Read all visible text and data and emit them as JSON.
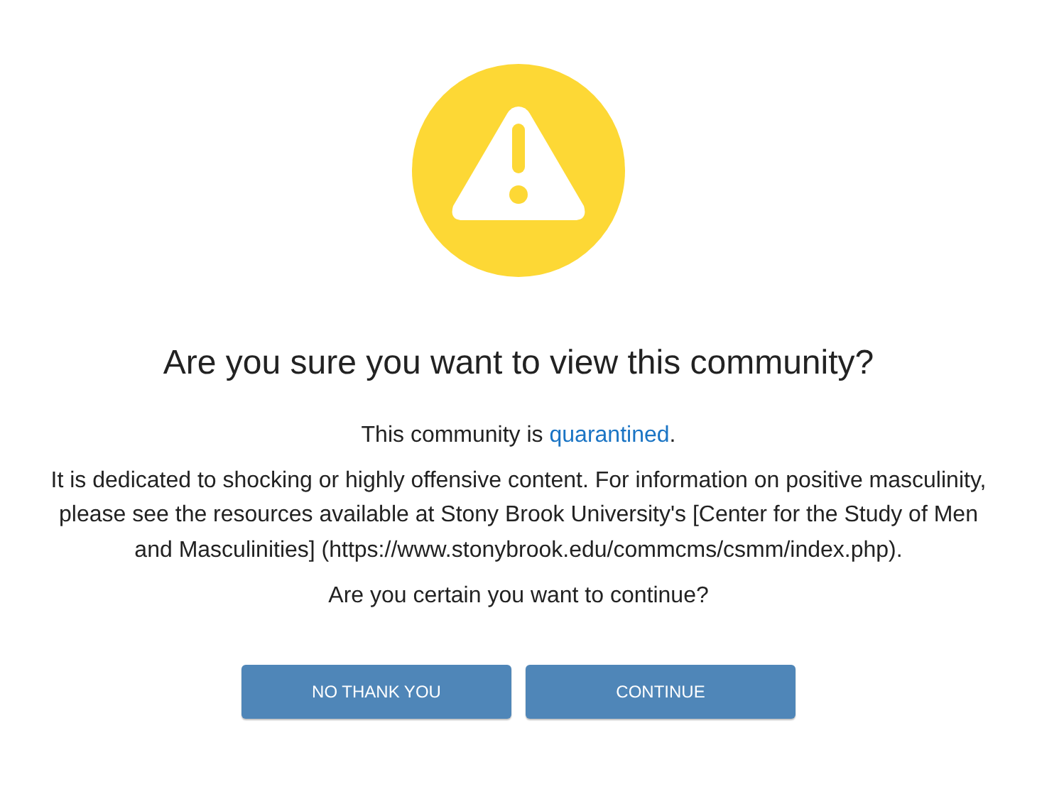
{
  "title": "Are you sure you want to view this community?",
  "notice": {
    "before": "This community is ",
    "link": "quarantined",
    "after": "."
  },
  "description": "It is dedicated to shocking or highly offensive content. For information on positive masculinity, please see the resources available at Stony Brook University's [Center for the Study of Men and Masculinities] (https://www.stonybrook.edu/commcms/csmm/index.php).",
  "question": "Are you certain you want to continue?",
  "buttons": [
    "NO THANK YOU",
    "CONTINUE"
  ]
}
